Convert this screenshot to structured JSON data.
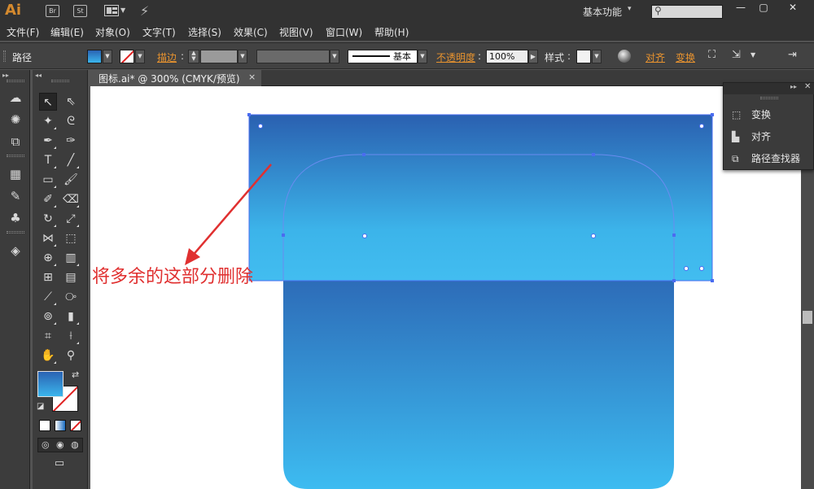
{
  "app": {
    "logo": "Ai",
    "bridge_badge": "Br",
    "stock_badge": "St",
    "workspace": "基本功能",
    "window_controls": [
      "—",
      "▢",
      "✕"
    ]
  },
  "menu": [
    "文件(F)",
    "编辑(E)",
    "对象(O)",
    "文字(T)",
    "选择(S)",
    "效果(C)",
    "视图(V)",
    "窗口(W)",
    "帮助(H)"
  ],
  "control_bar": {
    "selection_type": "路径",
    "stroke_label": "描边",
    "brush_label": "基本",
    "opacity_label": "不透明度",
    "opacity_value": "100%",
    "style_label": "样式",
    "align_label": "对齐",
    "transform_label": "变换"
  },
  "document": {
    "tab_title": "图标.ai* @ 300% (CMYK/预览)",
    "tab_close": "×"
  },
  "annotation": {
    "text": "将多余的这部分删除"
  },
  "floating_panel": {
    "items": [
      "变换",
      "对齐",
      "路径查找器"
    ]
  },
  "colors": {
    "gradient_top": "#2a63b3",
    "gradient_bottom": "#3bb5ec",
    "annotation": "#e03030",
    "anchor": "#4a6cf0",
    "accent_orange": "#e8932f"
  }
}
